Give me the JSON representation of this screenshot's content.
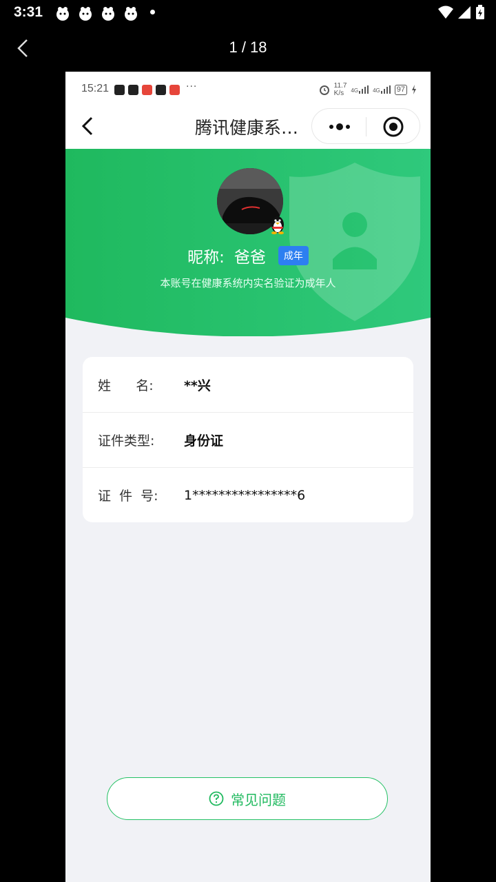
{
  "os_status": {
    "time": "3:31",
    "notif_icons": [
      "app-notification-icon",
      "app-notification-icon",
      "app-notification-icon",
      "app-notification-icon"
    ]
  },
  "viewer": {
    "counter": "1 / 18"
  },
  "inner_status": {
    "time": "15:21",
    "dots": "···",
    "net_speed_value": "11.7",
    "net_speed_unit": "K/s",
    "signal_label_1": "4G",
    "signal_label_2": "4G",
    "battery": "97"
  },
  "nav": {
    "title": "腾讯健康系…"
  },
  "profile": {
    "nick_prefix": "昵称:",
    "nick_name": "爸爸",
    "badge": "成年",
    "desc": "本账号在健康系统内实名验证为成年人"
  },
  "info": {
    "rows": [
      {
        "label": "姓      名:",
        "value": "**兴"
      },
      {
        "label": "证件类型:",
        "value": "身份证"
      },
      {
        "label": "证  件  号:",
        "value": "1****************6"
      }
    ]
  },
  "faq": {
    "label": "常见问题"
  },
  "colors": {
    "brand_green": "#22c063",
    "badge_blue": "#2d7ff1",
    "page_bg": "#f1f2f6"
  }
}
